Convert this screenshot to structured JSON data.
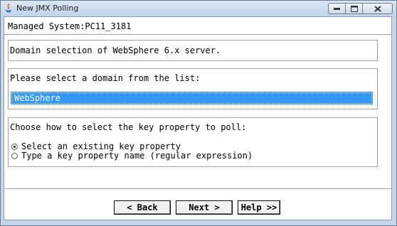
{
  "window": {
    "title": "New JMX Polling",
    "controls": [
      "minimize",
      "maximize",
      "close"
    ]
  },
  "header": {
    "managed_system": "Managed System:PC11_3181"
  },
  "domain_selection": {
    "text": "Domain selection of WebSphere 6.x server."
  },
  "domain_list": {
    "prompt": "Please select a domain from the list:",
    "items": [
      "WebSphere"
    ],
    "selected_index": 0
  },
  "key_property": {
    "prompt": "Choose how to select the key property to poll:",
    "options": [
      {
        "label": "Select an existing key property",
        "checked": true
      },
      {
        "label": "Type a key property name (regular expression)",
        "checked": false
      }
    ]
  },
  "buttons": {
    "back": "< Back",
    "next": "Next >",
    "help": "Help >>"
  },
  "colors": {
    "title_bar": "#c7d8ec",
    "selection": "#3399ff"
  }
}
